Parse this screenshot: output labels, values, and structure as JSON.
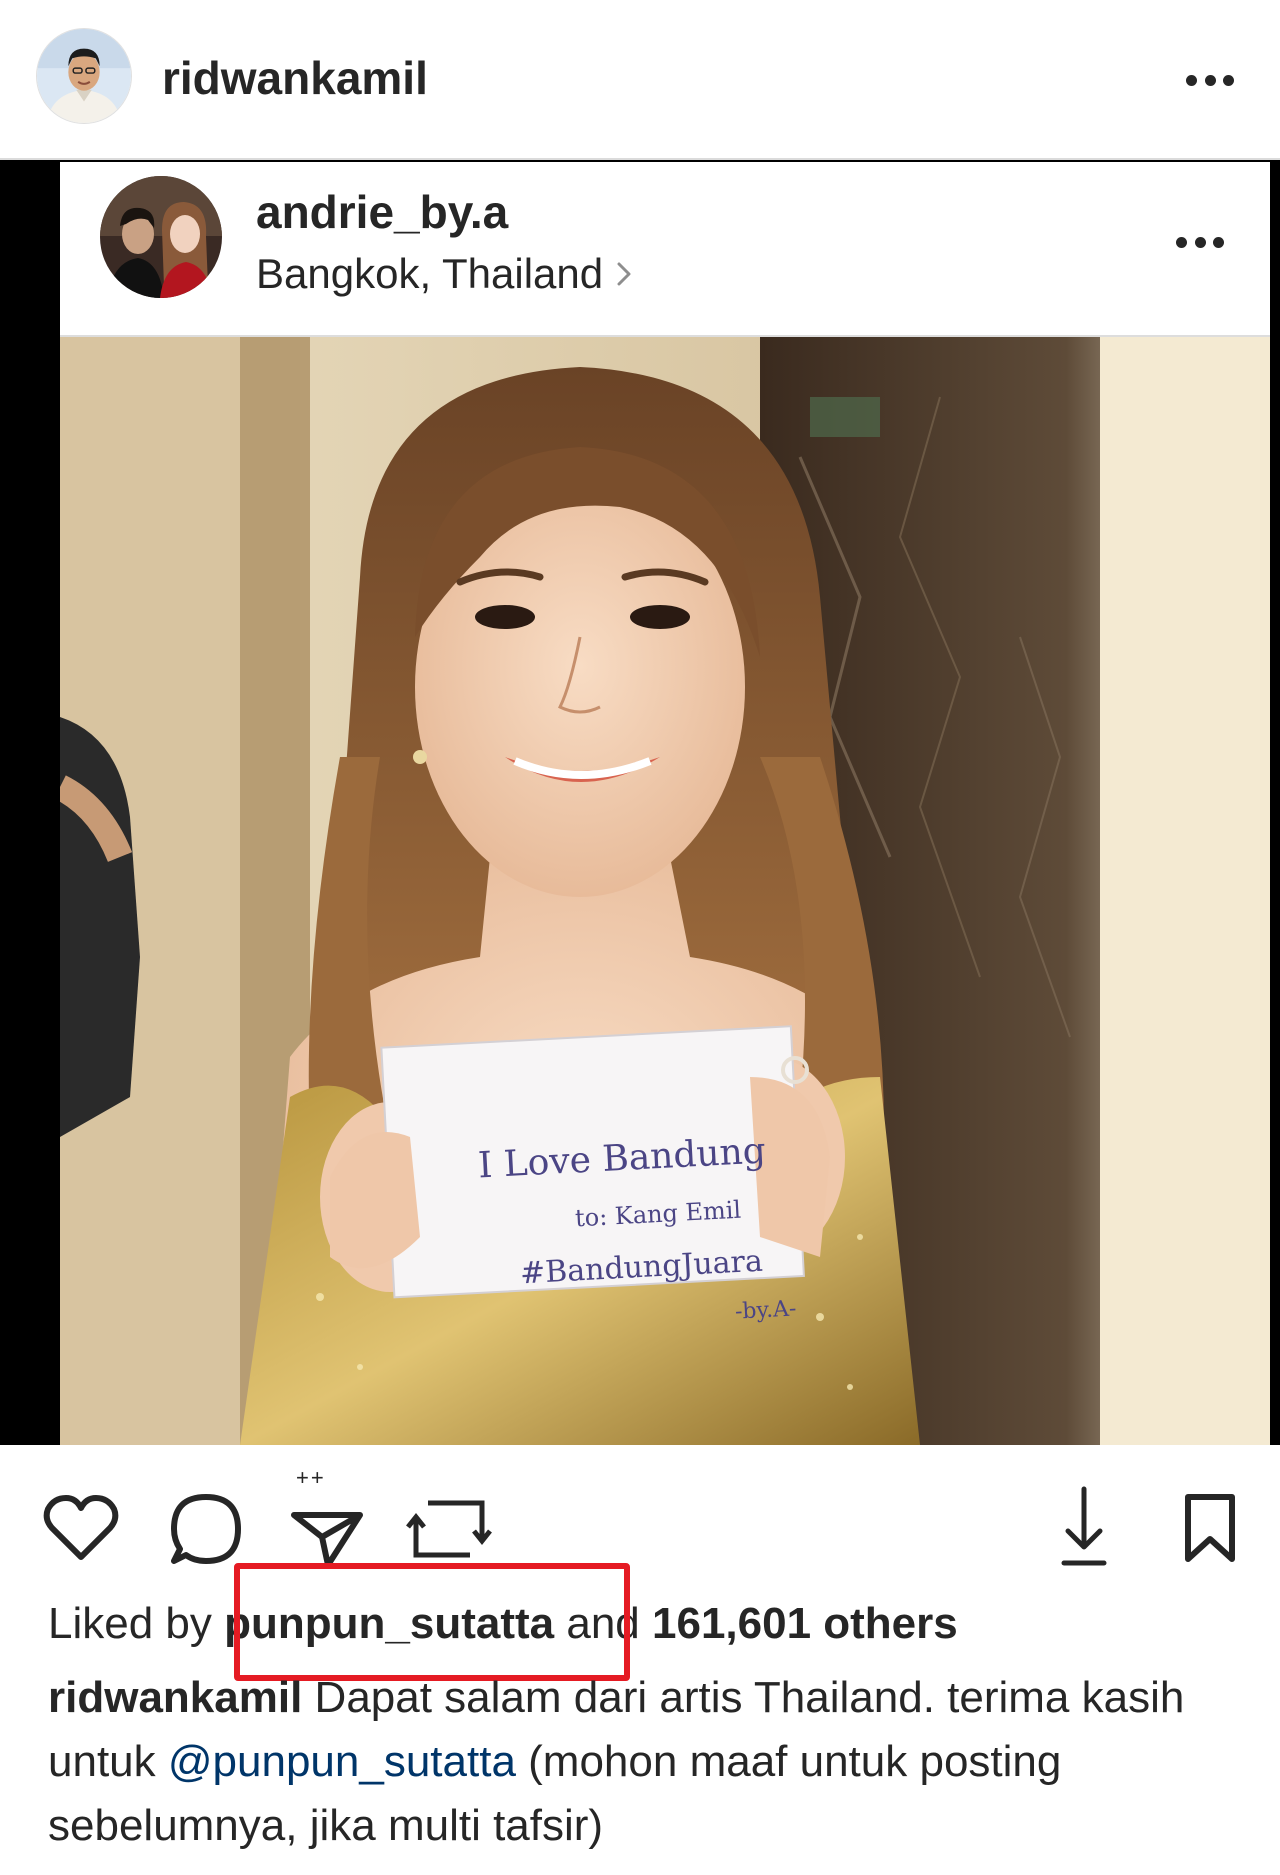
{
  "post": {
    "username": "ridwankamil",
    "avatar_icon": "profile-photo"
  },
  "embedded_post": {
    "username": "andrie_by.a",
    "location": "Bangkok, Thailand",
    "avatar_icon": "profile-photo",
    "photo": {
      "sign_lines": [
        "I Love Bandung",
        "to: Kang Emil",
        "#BandungJuara",
        "-by.A-"
      ]
    }
  },
  "actions": {
    "icons": [
      "heart-icon",
      "comment-icon",
      "share-icon",
      "repost-icon",
      "download-icon",
      "bookmark-icon"
    ],
    "share_badge": "++"
  },
  "likes": {
    "prefix": "Liked by",
    "user": "punpun_sutatta",
    "connector": "and",
    "count": "161,601 others"
  },
  "caption": {
    "username": "ridwankamil",
    "text_part1": "Dapat salam dari artis Thailand. terima kasih untuk",
    "mention": "@punpun_sutatta",
    "text_part2": "(mohon maaf untuk posting sebelumnya, jika multi tafsir)"
  },
  "colors": {
    "text": "#262626",
    "mention": "#003569",
    "highlight": "#e51b23",
    "frame": "#000000"
  }
}
